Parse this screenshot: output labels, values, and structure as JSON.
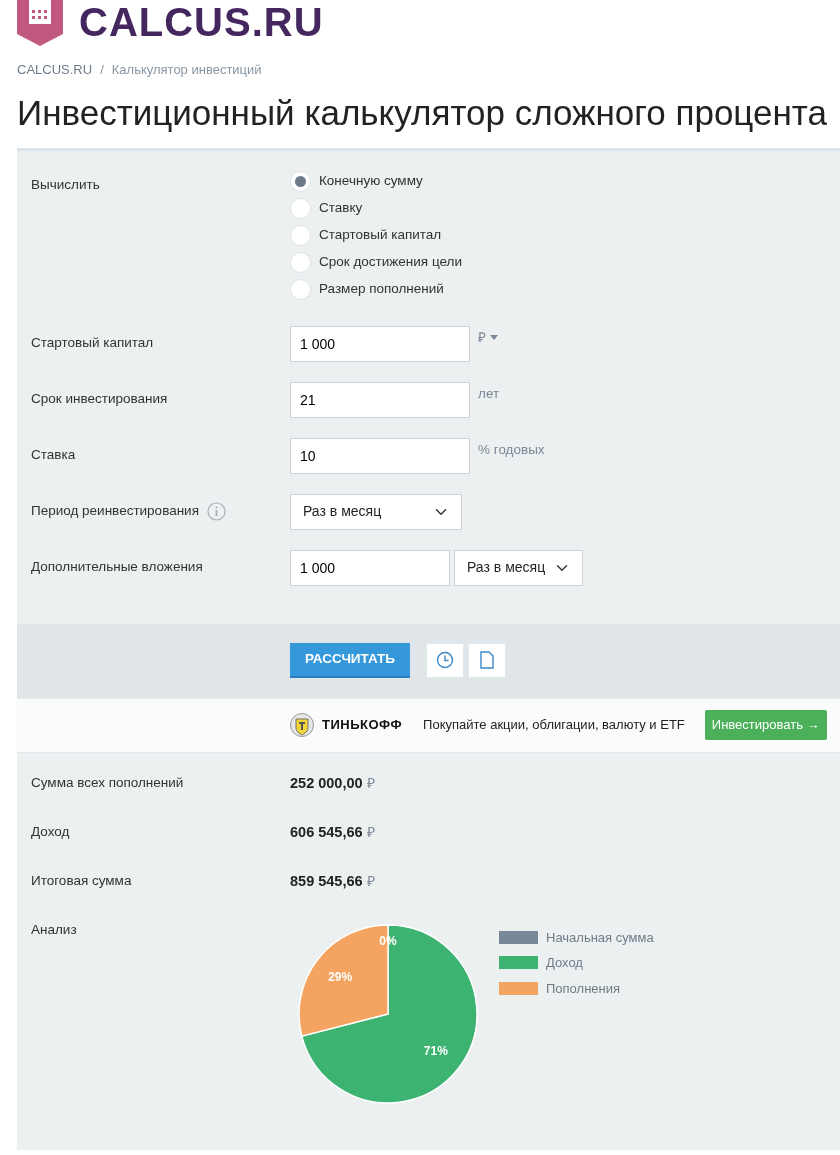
{
  "header": {
    "logo_text": "CALCUS.RU"
  },
  "breadcrumb": {
    "items": [
      "CALCUS.RU",
      "Калькулятор инвестиций"
    ],
    "separator": "/"
  },
  "title": "Инвестиционный калькулятор сложного процента",
  "form": {
    "calculate": {
      "label": "Вычислить",
      "options": [
        {
          "label": "Конечную сумму",
          "selected": true
        },
        {
          "label": "Ставку",
          "selected": false
        },
        {
          "label": "Стартовый капитал",
          "selected": false
        },
        {
          "label": "Срок достижения цели",
          "selected": false
        },
        {
          "label": "Размер пополнений",
          "selected": false
        }
      ]
    },
    "fields": [
      {
        "kind": "input",
        "label": "Стартовый капитал",
        "value": "1 000",
        "unit": "₽",
        "unit_dropdown": true
      },
      {
        "kind": "input",
        "label": "Срок инвестирования",
        "value": "21",
        "unit": "лет"
      },
      {
        "kind": "input",
        "label": "Ставка",
        "value": "10",
        "unit": "% годовых"
      },
      {
        "kind": "select",
        "label": "Период реинвестирования",
        "info": true,
        "value": "Раз в месяц"
      },
      {
        "kind": "input_select",
        "label": "Дополнительные вложения",
        "value": "1 000",
        "select_value": "Раз в месяц"
      }
    ]
  },
  "actions": {
    "calculate_button": "РАССЧИТАТЬ"
  },
  "ad": {
    "brand": "ТИНЬКОФФ",
    "text": "Покупайте акции, облигации, валюту и ETF",
    "button": "Инвестировать →"
  },
  "results": [
    {
      "label": "Сумма всех пополнений",
      "value": "252 000,00",
      "currency": "₽"
    },
    {
      "label": "Доход",
      "value": "606 545,66",
      "currency": "₽"
    },
    {
      "label": "Итоговая сумма",
      "value": "859 545,66",
      "currency": "₽"
    }
  ],
  "analysis": {
    "label": "Анализ",
    "chart_data": {
      "type": "pie",
      "categories": [
        "Начальная сумма",
        "Доход",
        "Пополнения"
      ],
      "values": [
        0,
        71,
        29
      ],
      "colors": [
        "#778899",
        "#3cb371",
        "#f4a460"
      ],
      "value_labels": [
        "0%",
        "71%",
        "29%"
      ]
    }
  }
}
